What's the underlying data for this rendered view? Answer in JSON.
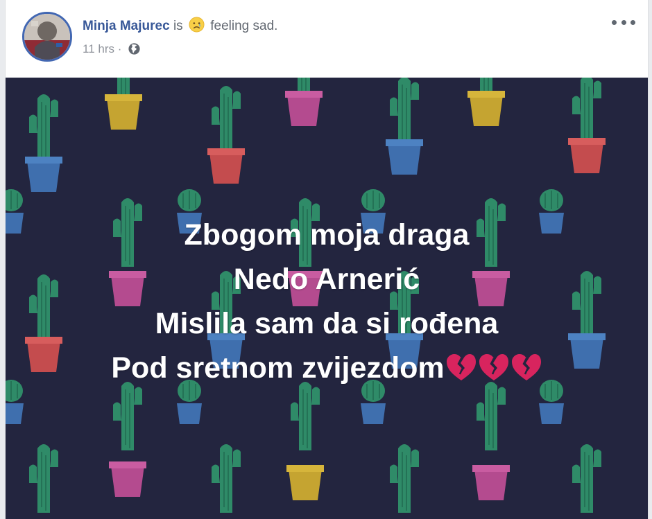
{
  "post": {
    "author": "Minja Majurec",
    "verb": "is",
    "feeling_icon": "sad-face-emoji-icon",
    "feeling": "feeling sad.",
    "time": "11 hrs",
    "separator": "·",
    "privacy_icon": "globe-icon",
    "more_icon": "more-options-icon"
  },
  "image_text": {
    "lines": [
      "Zbogom moja draga",
      "Nedo Arnerić",
      "Mislila sam da si rođena",
      "Pod sretnom zvijezdom"
    ],
    "trailing_icons": [
      "broken-heart-icon",
      "broken-heart-icon",
      "broken-heart-icon"
    ]
  },
  "colors": {
    "author_link": "#385898",
    "image_background": "#23253f",
    "text": "#ffffff",
    "broken_heart": "#e0245e"
  }
}
